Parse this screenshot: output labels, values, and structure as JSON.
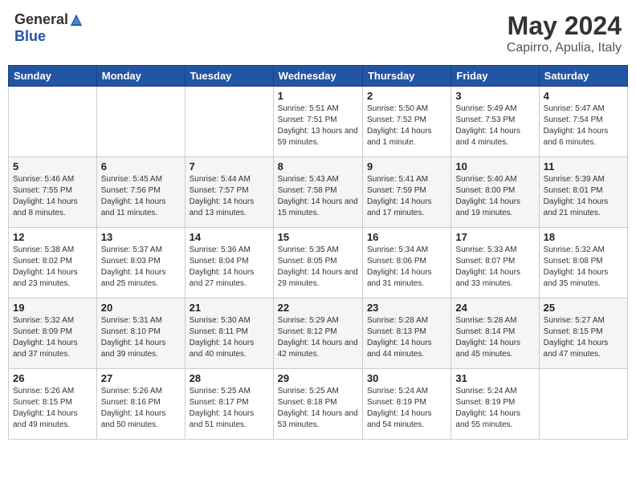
{
  "logo": {
    "general": "General",
    "blue": "Blue"
  },
  "title": "May 2024",
  "location": "Capirro, Apulia, Italy",
  "headers": [
    "Sunday",
    "Monday",
    "Tuesday",
    "Wednesday",
    "Thursday",
    "Friday",
    "Saturday"
  ],
  "weeks": [
    [
      {
        "day": "",
        "sunrise": "",
        "sunset": "",
        "daylight": ""
      },
      {
        "day": "",
        "sunrise": "",
        "sunset": "",
        "daylight": ""
      },
      {
        "day": "",
        "sunrise": "",
        "sunset": "",
        "daylight": ""
      },
      {
        "day": "1",
        "sunrise": "Sunrise: 5:51 AM",
        "sunset": "Sunset: 7:51 PM",
        "daylight": "Daylight: 13 hours and 59 minutes."
      },
      {
        "day": "2",
        "sunrise": "Sunrise: 5:50 AM",
        "sunset": "Sunset: 7:52 PM",
        "daylight": "Daylight: 14 hours and 1 minute."
      },
      {
        "day": "3",
        "sunrise": "Sunrise: 5:49 AM",
        "sunset": "Sunset: 7:53 PM",
        "daylight": "Daylight: 14 hours and 4 minutes."
      },
      {
        "day": "4",
        "sunrise": "Sunrise: 5:47 AM",
        "sunset": "Sunset: 7:54 PM",
        "daylight": "Daylight: 14 hours and 6 minutes."
      }
    ],
    [
      {
        "day": "5",
        "sunrise": "Sunrise: 5:46 AM",
        "sunset": "Sunset: 7:55 PM",
        "daylight": "Daylight: 14 hours and 8 minutes."
      },
      {
        "day": "6",
        "sunrise": "Sunrise: 5:45 AM",
        "sunset": "Sunset: 7:56 PM",
        "daylight": "Daylight: 14 hours and 11 minutes."
      },
      {
        "day": "7",
        "sunrise": "Sunrise: 5:44 AM",
        "sunset": "Sunset: 7:57 PM",
        "daylight": "Daylight: 14 hours and 13 minutes."
      },
      {
        "day": "8",
        "sunrise": "Sunrise: 5:43 AM",
        "sunset": "Sunset: 7:58 PM",
        "daylight": "Daylight: 14 hours and 15 minutes."
      },
      {
        "day": "9",
        "sunrise": "Sunrise: 5:41 AM",
        "sunset": "Sunset: 7:59 PM",
        "daylight": "Daylight: 14 hours and 17 minutes."
      },
      {
        "day": "10",
        "sunrise": "Sunrise: 5:40 AM",
        "sunset": "Sunset: 8:00 PM",
        "daylight": "Daylight: 14 hours and 19 minutes."
      },
      {
        "day": "11",
        "sunrise": "Sunrise: 5:39 AM",
        "sunset": "Sunset: 8:01 PM",
        "daylight": "Daylight: 14 hours and 21 minutes."
      }
    ],
    [
      {
        "day": "12",
        "sunrise": "Sunrise: 5:38 AM",
        "sunset": "Sunset: 8:02 PM",
        "daylight": "Daylight: 14 hours and 23 minutes."
      },
      {
        "day": "13",
        "sunrise": "Sunrise: 5:37 AM",
        "sunset": "Sunset: 8:03 PM",
        "daylight": "Daylight: 14 hours and 25 minutes."
      },
      {
        "day": "14",
        "sunrise": "Sunrise: 5:36 AM",
        "sunset": "Sunset: 8:04 PM",
        "daylight": "Daylight: 14 hours and 27 minutes."
      },
      {
        "day": "15",
        "sunrise": "Sunrise: 5:35 AM",
        "sunset": "Sunset: 8:05 PM",
        "daylight": "Daylight: 14 hours and 29 minutes."
      },
      {
        "day": "16",
        "sunrise": "Sunrise: 5:34 AM",
        "sunset": "Sunset: 8:06 PM",
        "daylight": "Daylight: 14 hours and 31 minutes."
      },
      {
        "day": "17",
        "sunrise": "Sunrise: 5:33 AM",
        "sunset": "Sunset: 8:07 PM",
        "daylight": "Daylight: 14 hours and 33 minutes."
      },
      {
        "day": "18",
        "sunrise": "Sunrise: 5:32 AM",
        "sunset": "Sunset: 8:08 PM",
        "daylight": "Daylight: 14 hours and 35 minutes."
      }
    ],
    [
      {
        "day": "19",
        "sunrise": "Sunrise: 5:32 AM",
        "sunset": "Sunset: 8:09 PM",
        "daylight": "Daylight: 14 hours and 37 minutes."
      },
      {
        "day": "20",
        "sunrise": "Sunrise: 5:31 AM",
        "sunset": "Sunset: 8:10 PM",
        "daylight": "Daylight: 14 hours and 39 minutes."
      },
      {
        "day": "21",
        "sunrise": "Sunrise: 5:30 AM",
        "sunset": "Sunset: 8:11 PM",
        "daylight": "Daylight: 14 hours and 40 minutes."
      },
      {
        "day": "22",
        "sunrise": "Sunrise: 5:29 AM",
        "sunset": "Sunset: 8:12 PM",
        "daylight": "Daylight: 14 hours and 42 minutes."
      },
      {
        "day": "23",
        "sunrise": "Sunrise: 5:28 AM",
        "sunset": "Sunset: 8:13 PM",
        "daylight": "Daylight: 14 hours and 44 minutes."
      },
      {
        "day": "24",
        "sunrise": "Sunrise: 5:28 AM",
        "sunset": "Sunset: 8:14 PM",
        "daylight": "Daylight: 14 hours and 45 minutes."
      },
      {
        "day": "25",
        "sunrise": "Sunrise: 5:27 AM",
        "sunset": "Sunset: 8:15 PM",
        "daylight": "Daylight: 14 hours and 47 minutes."
      }
    ],
    [
      {
        "day": "26",
        "sunrise": "Sunrise: 5:26 AM",
        "sunset": "Sunset: 8:15 PM",
        "daylight": "Daylight: 14 hours and 49 minutes."
      },
      {
        "day": "27",
        "sunrise": "Sunrise: 5:26 AM",
        "sunset": "Sunset: 8:16 PM",
        "daylight": "Daylight: 14 hours and 50 minutes."
      },
      {
        "day": "28",
        "sunrise": "Sunrise: 5:25 AM",
        "sunset": "Sunset: 8:17 PM",
        "daylight": "Daylight: 14 hours and 51 minutes."
      },
      {
        "day": "29",
        "sunrise": "Sunrise: 5:25 AM",
        "sunset": "Sunset: 8:18 PM",
        "daylight": "Daylight: 14 hours and 53 minutes."
      },
      {
        "day": "30",
        "sunrise": "Sunrise: 5:24 AM",
        "sunset": "Sunset: 8:19 PM",
        "daylight": "Daylight: 14 hours and 54 minutes."
      },
      {
        "day": "31",
        "sunrise": "Sunrise: 5:24 AM",
        "sunset": "Sunset: 8:19 PM",
        "daylight": "Daylight: 14 hours and 55 minutes."
      },
      {
        "day": "",
        "sunrise": "",
        "sunset": "",
        "daylight": ""
      }
    ]
  ]
}
